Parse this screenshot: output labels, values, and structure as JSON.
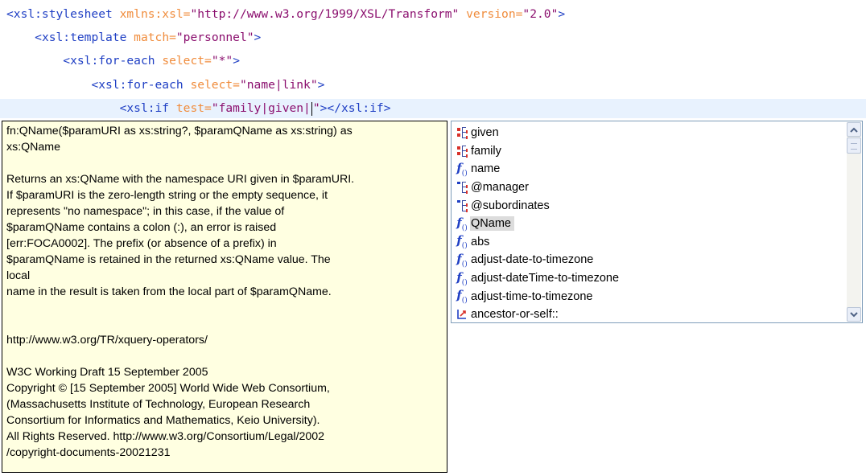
{
  "editor": {
    "lines": [
      {
        "indent": "",
        "parts": [
          [
            "tg",
            "<xsl:stylesheet "
          ],
          [
            "at",
            "xmlns:xsl="
          ],
          [
            "vl",
            "\"http://www.w3.org/1999/XSL/Transform\""
          ],
          [
            "at",
            " version="
          ],
          [
            "vl",
            "\"2.0\""
          ],
          [
            "tg",
            ">"
          ]
        ]
      },
      {
        "indent": "    ",
        "parts": [
          [
            "tg",
            "<xsl:template "
          ],
          [
            "at",
            "match="
          ],
          [
            "vl",
            "\"personnel\""
          ],
          [
            "tg",
            ">"
          ]
        ]
      },
      {
        "indent": "        ",
        "parts": [
          [
            "tg",
            "<xsl:for-each "
          ],
          [
            "at",
            "select="
          ],
          [
            "vl",
            "\"*\""
          ],
          [
            "tg",
            ">"
          ]
        ]
      },
      {
        "indent": "            ",
        "parts": [
          [
            "tg",
            "<xsl:for-each "
          ],
          [
            "at",
            "select="
          ],
          [
            "vl",
            "\"name|link\""
          ],
          [
            "tg",
            ">"
          ]
        ]
      }
    ],
    "current_line": {
      "indent": "                ",
      "before": [
        [
          "tg",
          "<xsl:if "
        ],
        [
          "at",
          "test="
        ],
        [
          "vl",
          "\"family|given|"
        ]
      ],
      "after": [
        [
          "vl",
          "\""
        ],
        [
          "tg",
          "></xsl:if>"
        ]
      ]
    },
    "partial_line_fragment": "</"
  },
  "documentation_tooltip": {
    "signature_lines": [
      "fn:QName($paramURI as xs:string?, $paramQName as xs:string) as",
      "xs:QName"
    ],
    "description_lines": [
      "Returns an xs:QName with the namespace URI given in $paramURI.",
      "If $paramURI is the zero-length string or the empty sequence, it",
      "represents \"no namespace\"; in this case, if the value of",
      "$paramQName contains a colon (:), an error is raised",
      "[err:FOCA0002]. The prefix (or absence of a prefix) in",
      "$paramQName is retained in the returned xs:QName value. The",
      "local",
      "name in the result is taken from the local part of $paramQName."
    ],
    "link": "http://www.w3.org/TR/xquery-operators/",
    "copyright_lines": [
      "W3C Working Draft 15 September 2005",
      "Copyright © [15 September 2005] World Wide Web Consortium,",
      "(Massachusetts Institute of Technology, European Research",
      "Consortium for Informatics and Mathematics, Keio University).",
      "All Rights Reserved. http://www.w3.org/Consortium/Legal/2002",
      "/copyright-documents-20021231"
    ]
  },
  "completion": {
    "items": [
      {
        "label": "given",
        "icon": "element-icon"
      },
      {
        "label": "family",
        "icon": "element-icon"
      },
      {
        "label": "name",
        "icon": "function-icon"
      },
      {
        "label": "@manager",
        "icon": "attribute-icon"
      },
      {
        "label": "@subordinates",
        "icon": "attribute-icon"
      },
      {
        "label": "QName",
        "icon": "function-icon",
        "selected": true
      },
      {
        "label": "abs",
        "icon": "function-icon"
      },
      {
        "label": "adjust-date-to-timezone",
        "icon": "function-icon"
      },
      {
        "label": "adjust-dateTime-to-timezone",
        "icon": "function-icon"
      },
      {
        "label": "adjust-time-to-timezone",
        "icon": "function-icon"
      },
      {
        "label": "ancestor-or-self::",
        "icon": "axis-icon"
      }
    ],
    "selected_index": 5
  },
  "colors": {
    "tag": "#1f3fc4",
    "attribute": "#f08c3c",
    "value": "#8b0f6e",
    "tooltip_bg": "#ffffe1",
    "current_line_bg": "#e8f2fe"
  }
}
